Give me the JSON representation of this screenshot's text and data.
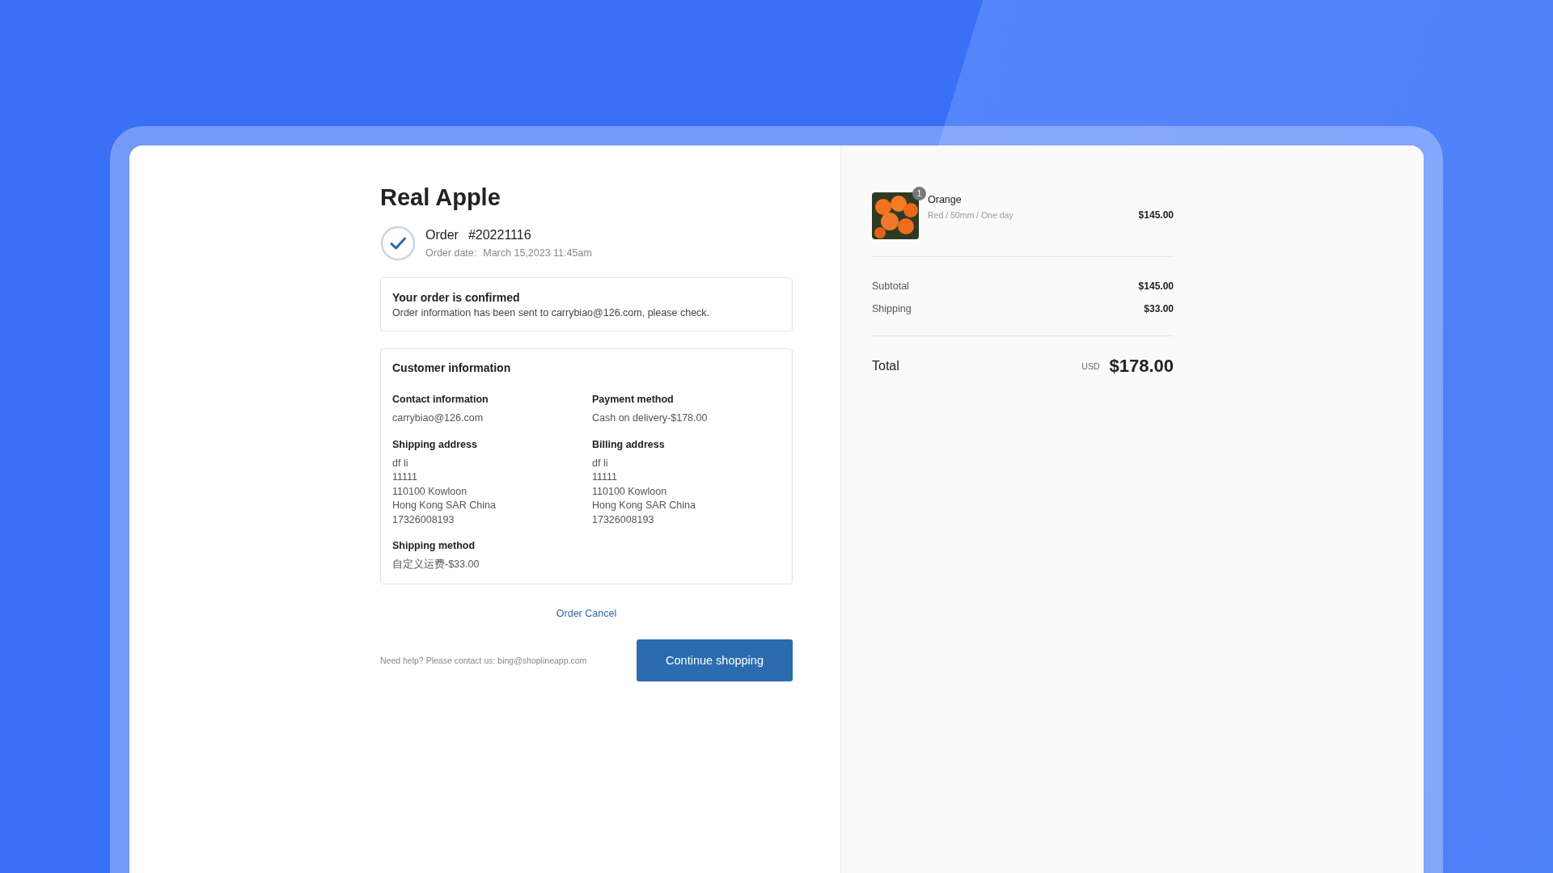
{
  "store": {
    "name": "Real Apple"
  },
  "order": {
    "label": "Order",
    "number": "#20221116",
    "date_label": "Order date:",
    "date": "March 15,2023 11:45am"
  },
  "confirmation": {
    "title": "Your order is confirmed",
    "message": "Order information has been sent to carrybiao@126.com, please check."
  },
  "customer_info": {
    "title": "Customer information",
    "sections": [
      {
        "heading": "Contact information",
        "lines": [
          "carrybiao@126.com"
        ]
      },
      {
        "heading": "Payment method",
        "lines": [
          "Cash on delivery-$178.00"
        ]
      },
      {
        "heading": "Shipping address",
        "lines": [
          "df li",
          "11111",
          "110100 Kowloon",
          "Hong Kong SAR China",
          "17326008193"
        ]
      },
      {
        "heading": "Billing address",
        "lines": [
          "df li",
          "11111",
          "110100 Kowloon",
          "Hong Kong SAR China",
          "17326008193"
        ]
      },
      {
        "heading": "Shipping method",
        "lines": [
          "自定义运费-$33.00"
        ]
      }
    ]
  },
  "cancel_link": "Order Cancel",
  "help_text": "Need help? Please contact us: bing@shoplineapp.com",
  "continue_button": "Continue shopping",
  "summary": {
    "items": [
      {
        "name": "Orange",
        "variant": "Red / 50mm / One day",
        "price": "$145.00",
        "quantity": "1"
      }
    ],
    "lines": [
      {
        "label": "Subtotal",
        "value": "$145.00"
      },
      {
        "label": "Shipping",
        "value": "$33.00"
      }
    ],
    "total": {
      "label": "Total",
      "currency": "USD",
      "value": "$178.00"
    }
  }
}
